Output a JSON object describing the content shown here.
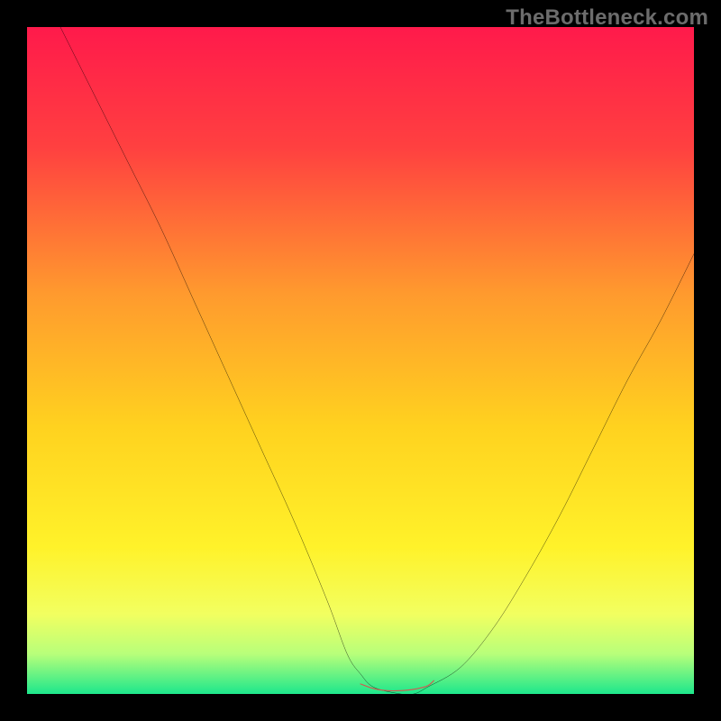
{
  "watermark": "TheBottleneck.com",
  "chart_data": {
    "type": "line",
    "title": "",
    "xlabel": "",
    "ylabel": "",
    "xlim": [
      0,
      100
    ],
    "ylim": [
      0,
      100
    ],
    "grid": false,
    "legend": false,
    "background_gradient_stops": [
      {
        "pct": 0,
        "color": "#ff1a4b"
      },
      {
        "pct": 18,
        "color": "#ff4040"
      },
      {
        "pct": 40,
        "color": "#ff9a2e"
      },
      {
        "pct": 60,
        "color": "#ffd21f"
      },
      {
        "pct": 78,
        "color": "#fff22a"
      },
      {
        "pct": 88,
        "color": "#f2ff60"
      },
      {
        "pct": 94,
        "color": "#b8ff7a"
      },
      {
        "pct": 100,
        "color": "#1de78c"
      }
    ],
    "series": [
      {
        "name": "curve",
        "color": "#000000",
        "x": [
          5,
          10,
          15,
          20,
          25,
          30,
          35,
          40,
          45,
          48,
          50,
          52,
          56,
          58,
          60,
          65,
          70,
          75,
          80,
          85,
          90,
          95,
          100
        ],
        "y": [
          100,
          90,
          80,
          70,
          59,
          48,
          37,
          26,
          14,
          6,
          3,
          1,
          0,
          0,
          1,
          4,
          10,
          18,
          27,
          37,
          47,
          56,
          66
        ]
      },
      {
        "name": "trough-marker",
        "color": "#d9534f",
        "x": [
          50,
          52,
          54,
          56,
          58,
          60,
          61
        ],
        "y": [
          1.5,
          0.8,
          0.5,
          0.5,
          0.7,
          1.2,
          2
        ]
      }
    ]
  }
}
